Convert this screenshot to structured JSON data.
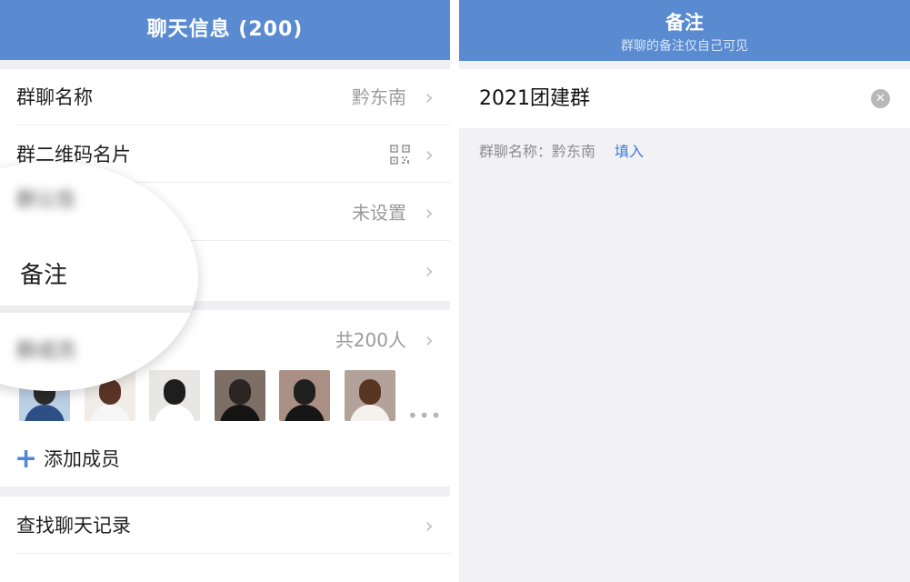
{
  "left": {
    "title": "聊天信息 (200)",
    "rows": {
      "group_name": {
        "label": "群聊名称",
        "value": "黔东南"
      },
      "qr_code": {
        "label": "群二维码名片"
      },
      "announcement": {
        "label": "群公告",
        "value": "未设置"
      },
      "remark": {
        "label": "备注"
      },
      "members": {
        "label": "群成员",
        "value": "共200人"
      }
    },
    "avatars": [
      {
        "name": "member-1",
        "bg": "#bcd0e6",
        "head": "#2b2b2b",
        "body": "#2e4f86"
      },
      {
        "name": "member-2",
        "bg": "#f1ece7",
        "head": "#5a3527",
        "body": "#f6f6f6"
      },
      {
        "name": "member-3",
        "bg": "#e9e7e4",
        "head": "#1e1e1e",
        "body": "#ffffff"
      },
      {
        "name": "member-4",
        "bg": "#7d6e66",
        "head": "#2c2522",
        "body": "#141414"
      },
      {
        "name": "member-5",
        "bg": "#a98f84",
        "head": "#202020",
        "body": "#161616"
      },
      {
        "name": "member-6",
        "bg": "#b2a29a",
        "head": "#593624",
        "body": "#f5f1ec"
      }
    ],
    "more_indicator": "•••",
    "add_member": {
      "icon": "plus-icon",
      "label": "添加成员"
    },
    "search_history": {
      "label": "查找聊天记录"
    },
    "magnifier": {
      "remark_label": "备注"
    }
  },
  "right": {
    "title": "备注",
    "subtitle": "群聊的备注仅自己可见",
    "input_value": "2021团建群",
    "clear_icon": "clear-icon",
    "hint": "群聊名称：黔东南",
    "fill_button": "填入"
  },
  "colors": {
    "header_blue": "#5a8bd1",
    "link_blue": "#3d7bd4",
    "bg_gray": "#f0f0f2"
  }
}
